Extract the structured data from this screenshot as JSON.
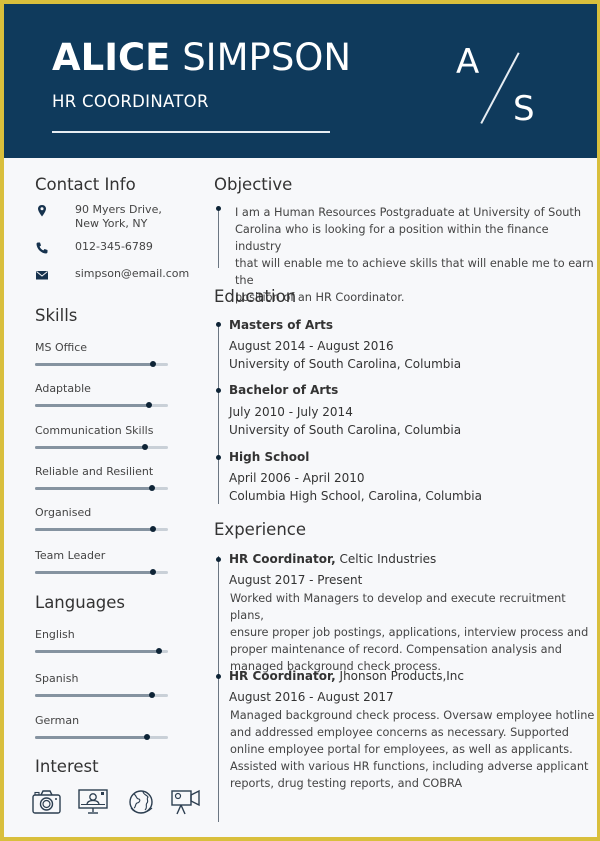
{
  "header": {
    "first_name": "ALICE",
    "last_name": "SIMPSON",
    "role": "HR COORDINATOR",
    "monogram": {
      "first": "A",
      "second": "S"
    },
    "background_color": "#0f3a5c"
  },
  "frame_color": "#d9bf3c",
  "contact": {
    "title": "Contact Info",
    "items": [
      {
        "icon": "map-pin-icon",
        "lines": [
          "90 Myers Drive,",
          "New York, NY"
        ]
      },
      {
        "icon": "phone-icon",
        "lines": [
          "012-345-6789"
        ]
      },
      {
        "icon": "email-icon",
        "lines": [
          "simpson@email.com"
        ]
      }
    ]
  },
  "skills": {
    "title": "Skills",
    "items": [
      {
        "label": "MS Office",
        "level": 0.89
      },
      {
        "label": "Adaptable",
        "level": 0.86
      },
      {
        "label": "Communication Skills",
        "level": 0.83
      },
      {
        "label": "Reliable and Resilient",
        "level": 0.88
      },
      {
        "label": "Organised",
        "level": 0.89
      },
      {
        "label": "Team Leader",
        "level": 0.89
      }
    ]
  },
  "languages": {
    "title": "Languages",
    "items": [
      {
        "label": "English",
        "level": 0.93
      },
      {
        "label": "Spanish",
        "level": 0.88
      },
      {
        "label": "German",
        "level": 0.84
      }
    ]
  },
  "interest": {
    "title": "Interest",
    "icons": [
      "camera-icon",
      "computer-user-icon",
      "globe-icon",
      "video-camera-icon"
    ]
  },
  "objective": {
    "title": "Objective",
    "lines": [
      "I am a Human Resources Postgraduate at University of South",
      "Carolina who is looking for a position within the finance industry",
      "that will enable me to achieve skills that will enable me to earn the",
      "position of an HR Coordinator."
    ]
  },
  "education": {
    "title": "Education",
    "items": [
      {
        "degree": "Masters of Arts",
        "dates": "August 2014 - August 2016",
        "school": "University of South Carolina, Columbia"
      },
      {
        "degree": "Bachelor of Arts",
        "dates": "July 2010 - July 2014",
        "school": "University of South Carolina, Columbia"
      },
      {
        "degree": "High School",
        "dates": "April 2006 - April 2010",
        "school": "Columbia High School, Carolina, Columbia"
      }
    ]
  },
  "experience": {
    "title": "Experience",
    "items": [
      {
        "role": "HR Coordinator,",
        "company": " Celtic Industries",
        "dates": "August 2017 - Present",
        "lines": [
          "Worked with Managers to develop and execute recruitment plans,",
          "ensure proper job postings, applications, interview process and",
          "proper maintenance of record. Compensation analysis and",
          "managed background check process."
        ]
      },
      {
        "role": "HR Coordinator,",
        "company": " Jhonson Products,Inc",
        "dates": "August 2016 - August 2017",
        "lines": [
          "Managed background check process. Oversaw employee hotline",
          "and addressed employee concerns as necessary. Supported",
          "online employee portal for employees, as well as applicants.",
          "Assisted with various HR functions, including adverse applicant",
          "reports, drug testing reports, and COBRA"
        ]
      }
    ]
  }
}
